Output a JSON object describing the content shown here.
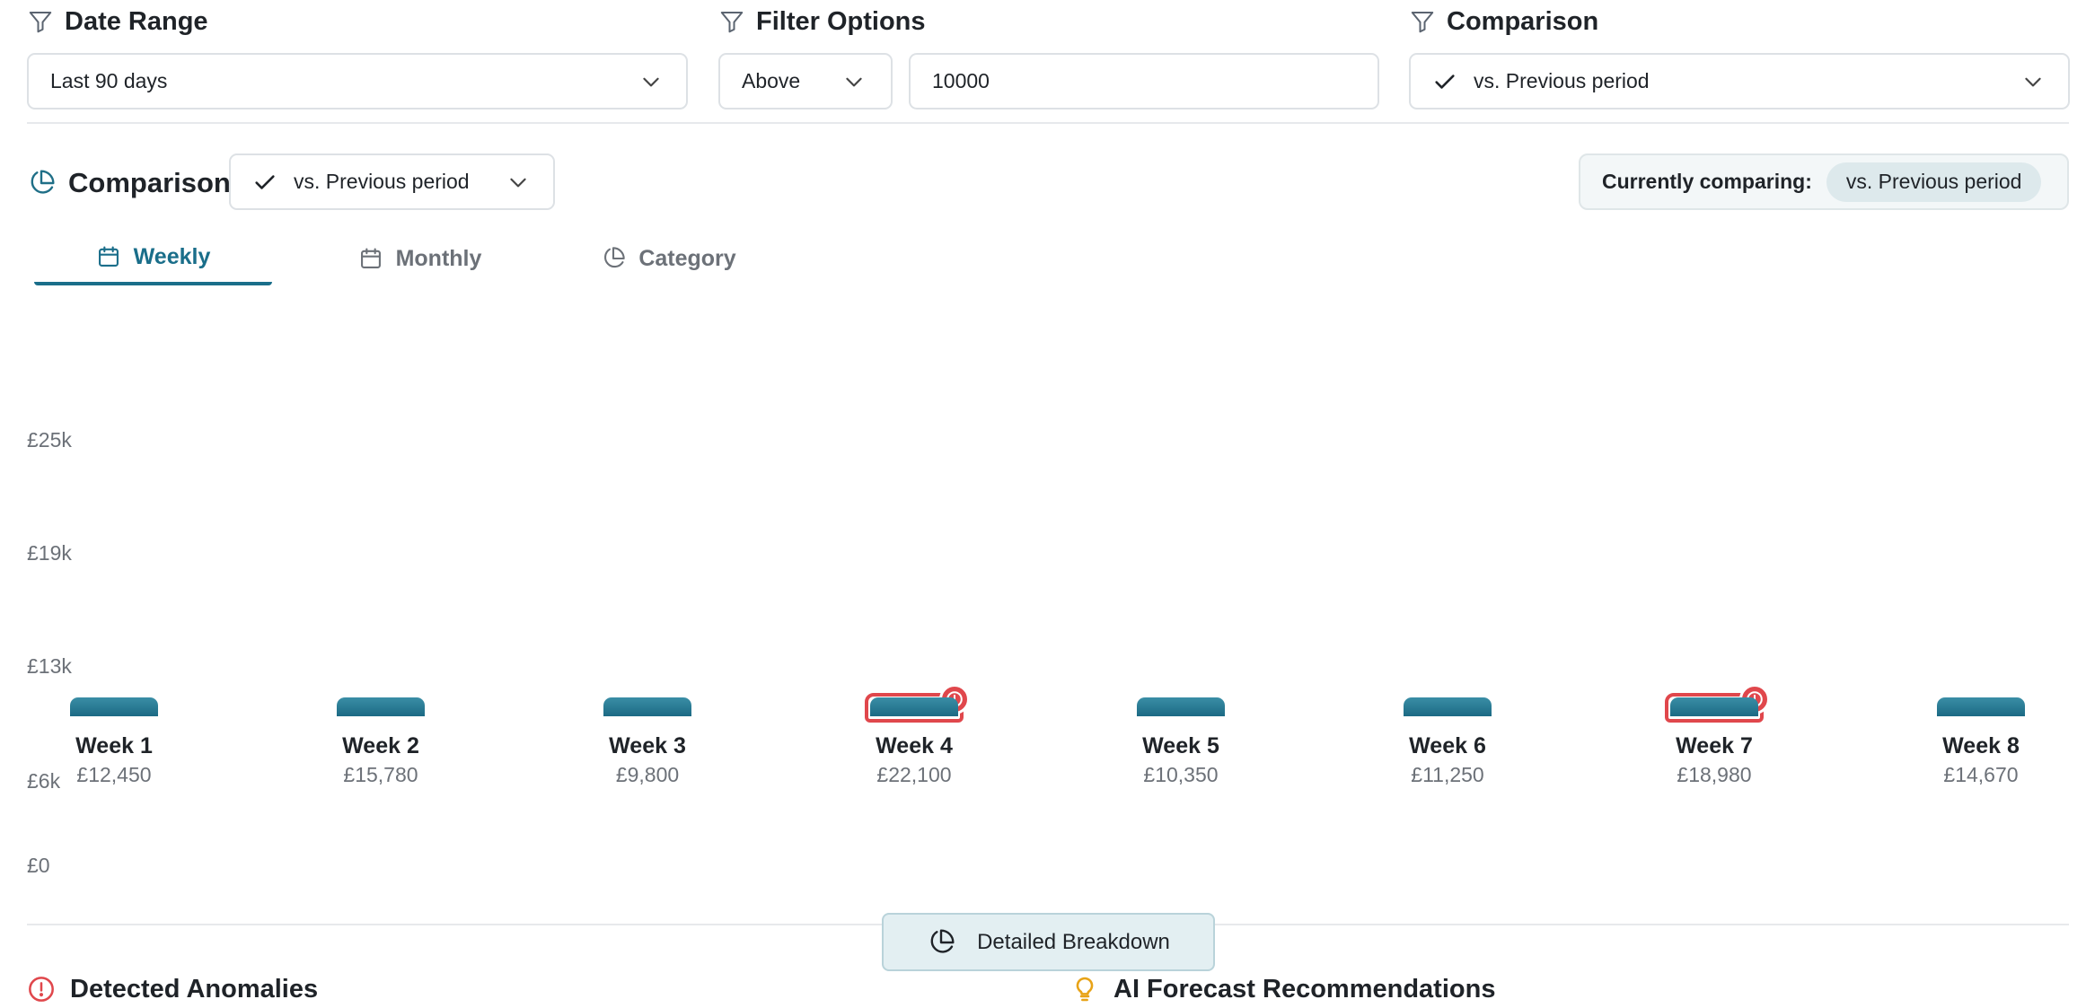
{
  "filters": {
    "date_range": {
      "title": "Date Range",
      "value": "Last 90 days",
      "icon": "filter-icon"
    },
    "filter_options": {
      "title": "Filter Options",
      "operator": "Above",
      "threshold": "10000",
      "icon": "filter-icon"
    },
    "comparison": {
      "title": "Comparison",
      "value": "vs. Previous period",
      "icon": "filter-icon"
    }
  },
  "comparison_bar": {
    "title": "Comparison",
    "select_value": "vs. Previous period",
    "currently_label": "Currently comparing:",
    "currently_value": "vs. Previous period"
  },
  "tabs": [
    {
      "label": "Weekly",
      "icon": "calendar-icon",
      "active": true
    },
    {
      "label": "Monthly",
      "icon": "calendar-icon",
      "active": false
    },
    {
      "label": "Category",
      "icon": "pie-chart-icon",
      "active": false
    }
  ],
  "chart_data": {
    "type": "bar",
    "categories": [
      "Week 1",
      "Week 2",
      "Week 3",
      "Week 4",
      "Week 5",
      "Week 6",
      "Week 7",
      "Week 8"
    ],
    "values": [
      12450,
      15780,
      9800,
      22100,
      10350,
      11250,
      18980,
      14670
    ],
    "value_labels": [
      "£12,450",
      "£15,780",
      "£9,800",
      "£22,100",
      "£10,350",
      "£11,250",
      "£18,980",
      "£14,670"
    ],
    "anomalies": [
      false,
      false,
      false,
      true,
      false,
      false,
      true,
      false
    ],
    "y_ticks": [
      "£25k",
      "£19k",
      "£13k",
      "£6k",
      "£0"
    ],
    "colors": {
      "bar": "#1c6a84",
      "anomaly": "#e0474c"
    }
  },
  "breakdown_button": {
    "label": "Detailed Breakdown",
    "icon": "pie-chart-icon"
  },
  "sections": {
    "anomalies_title": "Detected Anomalies",
    "recommendations_title": "AI Forecast Recommendations"
  }
}
